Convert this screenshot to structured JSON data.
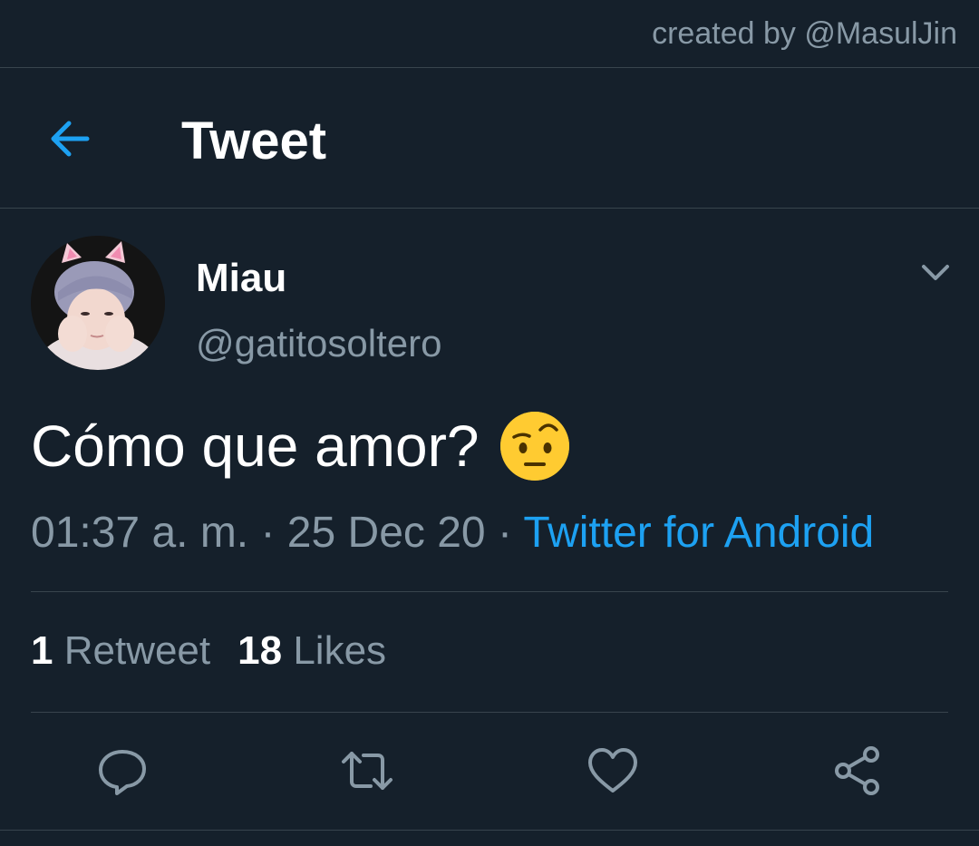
{
  "watermark": "created by @MasulJin",
  "header": {
    "title": "Tweet",
    "back_icon": "arrow-left-icon"
  },
  "author": {
    "display_name": "Miau",
    "handle": "@gatitosoltero",
    "avatar": "avatar-photo"
  },
  "tweet": {
    "text": "Cómo que amor?",
    "emoji": "face-with-raised-eyebrow-emoji",
    "time": "01:37 a. m.",
    "separator1": " · ",
    "date": "25 Dec 20",
    "separator2": " · ",
    "source": "Twitter for Android"
  },
  "stats": {
    "retweets_count": "1",
    "retweets_label": "Retweet",
    "likes_count": "18",
    "likes_label": "Likes"
  },
  "actions": [
    "reply-icon",
    "retweet-icon",
    "like-icon",
    "share-icon"
  ],
  "colors": {
    "background": "#15202b",
    "accent": "#1da1f2",
    "secondary_text": "#8899a6",
    "divider": "#38444d"
  }
}
